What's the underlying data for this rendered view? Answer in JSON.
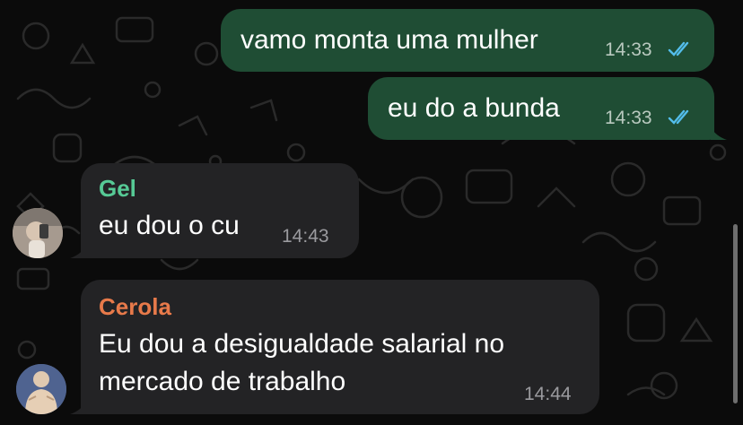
{
  "colors": {
    "background": "#0b0b0b",
    "outgoing_bubble": "#1f4d34",
    "incoming_bubble": "#232325",
    "read_ticks": "#53bdeb"
  },
  "messages": [
    {
      "direction": "outgoing",
      "text": "vamo monta uma mulher",
      "time": "14:33",
      "status": "read"
    },
    {
      "direction": "outgoing",
      "text": "eu do a bunda",
      "time": "14:33",
      "status": "read"
    },
    {
      "direction": "incoming",
      "sender": "Gel",
      "sender_color": "#56c995",
      "text": "eu dou o cu",
      "time": "14:43",
      "avatar_icon": "user-photo-avatar"
    },
    {
      "direction": "incoming",
      "sender": "Cerola",
      "sender_color": "#e87a4a",
      "text_line1": "Eu dou a desigualdade salarial no",
      "text_line2": "mercado de trabalho",
      "time": "14:44",
      "avatar_icon": "statue-avatar"
    }
  ]
}
